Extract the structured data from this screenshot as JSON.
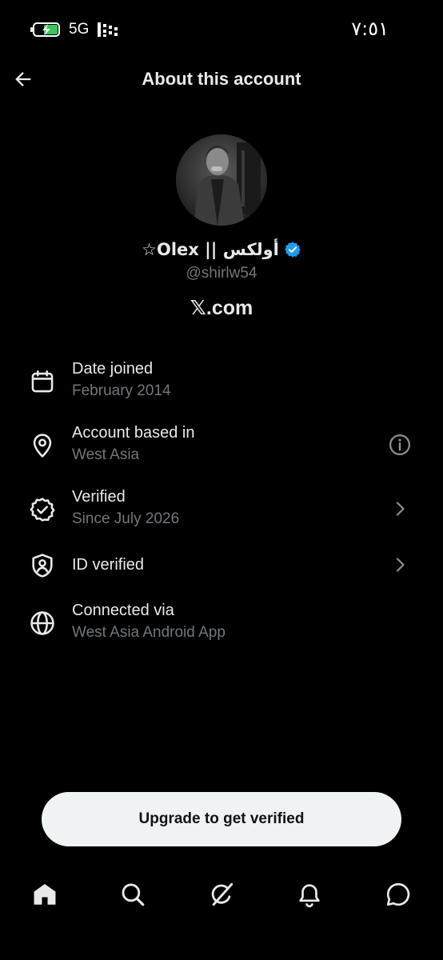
{
  "status_bar": {
    "network": "5G",
    "time": "٧:٥١"
  },
  "header": {
    "title": "About this account"
  },
  "profile": {
    "display_name": "☆Olex || أولكس",
    "handle": "@shirlw54",
    "site": "𝕏.com",
    "badge_color": "#1d9bf0"
  },
  "info": {
    "date_joined": {
      "title": "Date joined",
      "value": "February 2014",
      "icon": "calendar-icon"
    },
    "based_in": {
      "title": "Account based in",
      "value": "West Asia",
      "icon": "location-pin-icon",
      "trailing": "info-icon"
    },
    "verified": {
      "title": "Verified",
      "value": "Since July 2026",
      "icon": "verified-seal-icon",
      "trailing": "chevron-right-icon"
    },
    "id_verified": {
      "title": "ID verified",
      "icon": "shield-user-icon",
      "trailing": "chevron-right-icon"
    },
    "connected_via": {
      "title": "Connected via",
      "value": "West Asia Android App",
      "icon": "globe-icon"
    }
  },
  "upgrade_button": {
    "label": "Upgrade to get verified"
  },
  "bottom_nav": [
    "home-icon",
    "search-icon",
    "grok-icon",
    "bell-icon",
    "chat-icon"
  ]
}
